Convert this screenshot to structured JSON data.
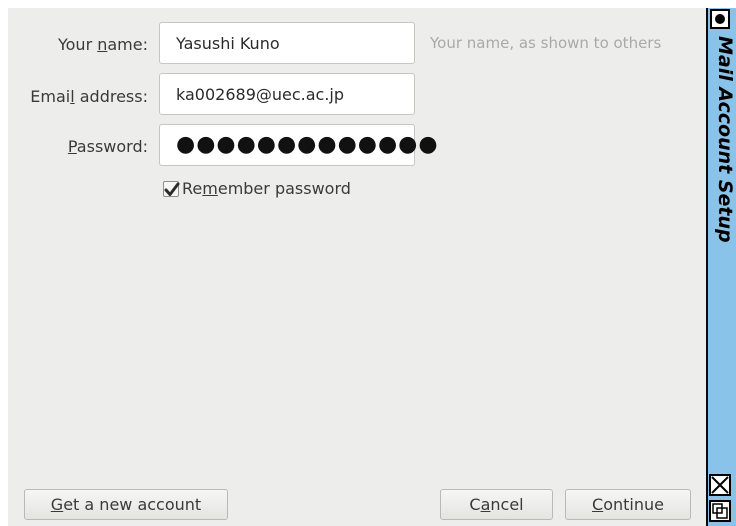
{
  "dialog": {
    "title": "Mail Account Setup",
    "name_label_pre": "Your ",
    "name_label_u": "n",
    "name_label_post": "ame:",
    "name_value": "Yasushi Kuno",
    "name_hint": "Your name, as shown to others",
    "email_label_pre": "Emai",
    "email_label_u": "l",
    "email_label_post": " address:",
    "email_value": "ka002689@uec.ac.jp",
    "password_label_u": "P",
    "password_label_post": "assword:",
    "password_mask": "●●●●●●●●●●●●●",
    "remember_pre": "Re",
    "remember_u": "m",
    "remember_post": "ember password",
    "remember_checked": true
  },
  "buttons": {
    "new_account_u": "G",
    "new_account_post": "et a new account",
    "cancel_pre": "C",
    "cancel_u": "a",
    "cancel_post": "ncel",
    "continue_u": "C",
    "continue_post": "ontinue"
  },
  "colors": {
    "dialog_bg": "#ededeb",
    "titlebar_bg": "#89c3ea",
    "hint_text": "#a9a9a6"
  },
  "icons": [
    "checkmark-icon",
    "window-menu-icon",
    "close-icon",
    "maximize-icon"
  ]
}
